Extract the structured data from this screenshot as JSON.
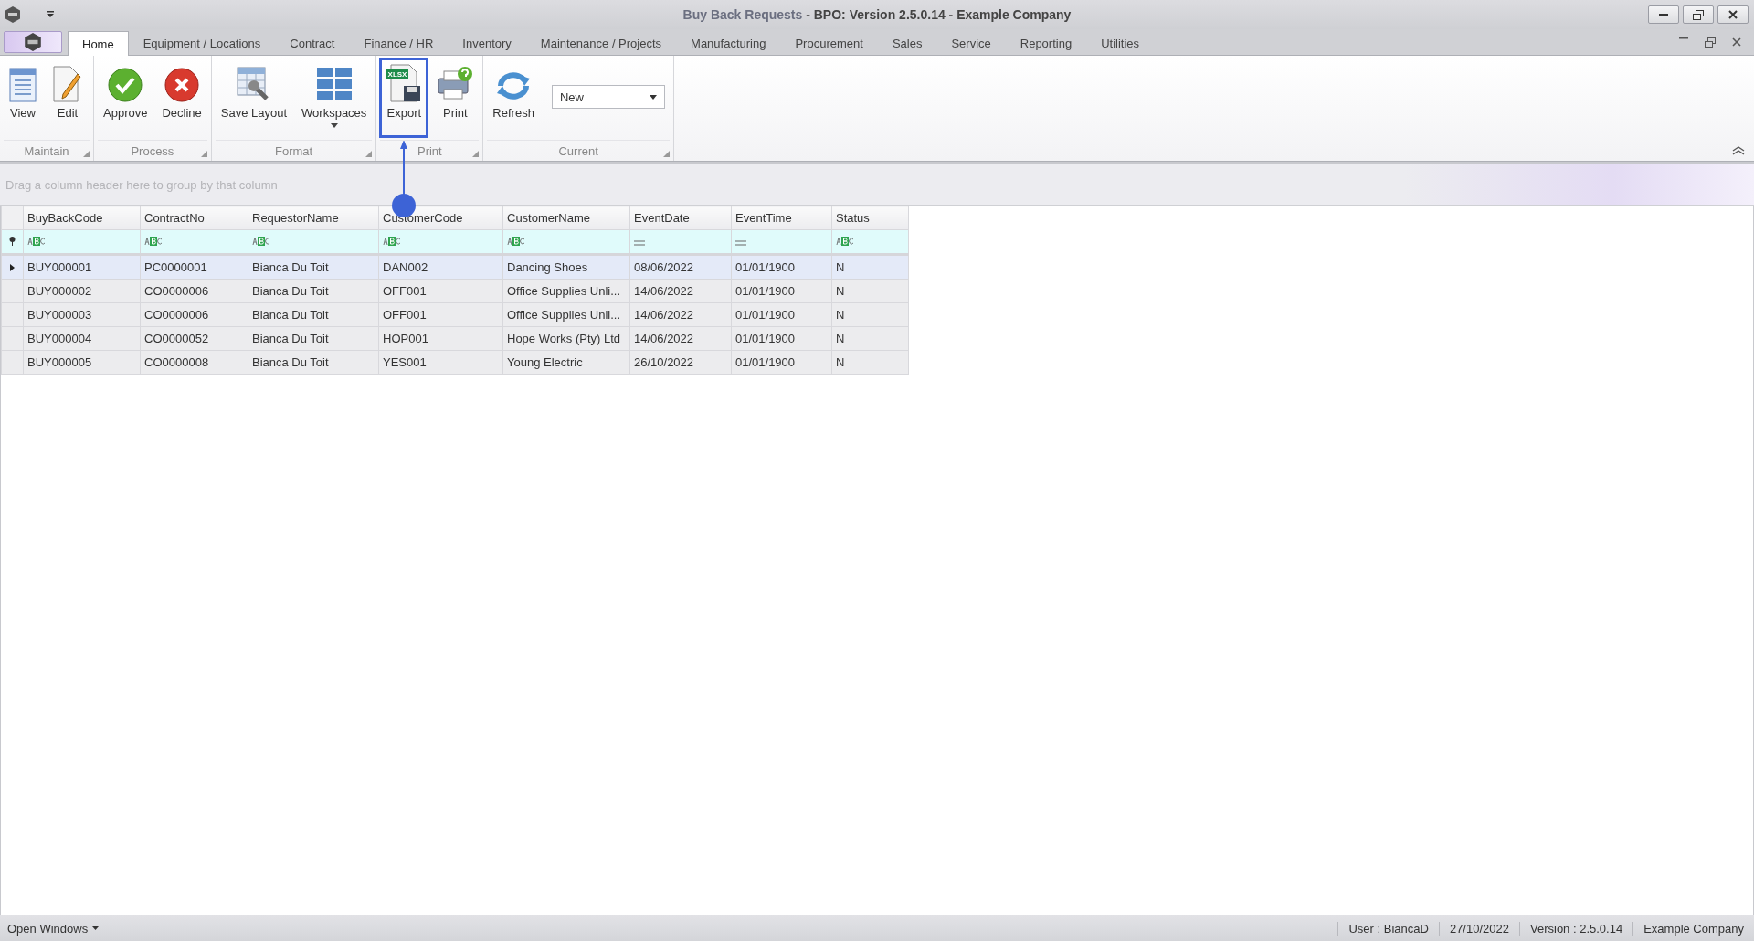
{
  "window": {
    "title_document": "Buy Back Requests",
    "title_app": "- BPO: Version 2.5.0.14 - Example Company"
  },
  "tabs": [
    {
      "label": "Home",
      "selected": true
    },
    {
      "label": "Equipment / Locations",
      "selected": false
    },
    {
      "label": "Contract",
      "selected": false
    },
    {
      "label": "Finance / HR",
      "selected": false
    },
    {
      "label": "Inventory",
      "selected": false
    },
    {
      "label": "Maintenance / Projects",
      "selected": false
    },
    {
      "label": "Manufacturing",
      "selected": false
    },
    {
      "label": "Procurement",
      "selected": false
    },
    {
      "label": "Sales",
      "selected": false
    },
    {
      "label": "Service",
      "selected": false
    },
    {
      "label": "Reporting",
      "selected": false
    },
    {
      "label": "Utilities",
      "selected": false
    }
  ],
  "ribbon": {
    "groups": [
      {
        "label": "Maintain",
        "items": [
          {
            "kind": "button",
            "label": "View",
            "highlighted": false
          },
          {
            "kind": "button",
            "label": "Edit",
            "highlighted": false
          }
        ]
      },
      {
        "label": "Process",
        "items": [
          {
            "kind": "button",
            "label": "Approve",
            "highlighted": false
          },
          {
            "kind": "button",
            "label": "Decline",
            "highlighted": false
          }
        ]
      },
      {
        "label": "Format",
        "items": [
          {
            "kind": "button",
            "label": "Save Layout",
            "highlighted": false
          },
          {
            "kind": "menu-button",
            "label": "Workspaces",
            "highlighted": false
          }
        ]
      },
      {
        "label": "Print",
        "items": [
          {
            "kind": "button",
            "label": "Export",
            "badge": "XLSX",
            "highlighted": true
          },
          {
            "kind": "button",
            "label": "Print",
            "highlighted": false
          }
        ]
      },
      {
        "label": "Current",
        "items": [
          {
            "kind": "button",
            "label": "Refresh",
            "highlighted": false
          },
          {
            "kind": "combo",
            "value": "New"
          }
        ]
      }
    ]
  },
  "grid": {
    "group_panel_hint": "Drag a column header here to group by that column",
    "columns": [
      {
        "label": "BuyBackCode",
        "kind": "text"
      },
      {
        "label": "ContractNo",
        "kind": "text"
      },
      {
        "label": "RequestorName",
        "kind": "text"
      },
      {
        "label": "CustomerCode",
        "kind": "text"
      },
      {
        "label": "CustomerName",
        "kind": "text"
      },
      {
        "label": "EventDate",
        "kind": "date"
      },
      {
        "label": "EventTime",
        "kind": "date"
      },
      {
        "label": "Status",
        "kind": "text"
      }
    ],
    "rows": [
      {
        "selected": true,
        "cells": [
          "BUY000001",
          "PC0000001",
          "Bianca Du Toit",
          "DAN002",
          "Dancing Shoes",
          "08/06/2022",
          "01/01/1900",
          "N"
        ]
      },
      {
        "selected": false,
        "cells": [
          "BUY000002",
          "CO0000006",
          "Bianca Du Toit",
          "OFF001",
          "Office Supplies Unli...",
          "14/06/2022",
          "01/01/1900",
          "N"
        ]
      },
      {
        "selected": false,
        "cells": [
          "BUY000003",
          "CO0000006",
          "Bianca Du Toit",
          "OFF001",
          "Office Supplies Unli...",
          "14/06/2022",
          "01/01/1900",
          "N"
        ]
      },
      {
        "selected": false,
        "cells": [
          "BUY000004",
          "CO0000052",
          "Bianca Du Toit",
          "HOP001",
          "Hope Works (Pty) Ltd",
          "14/06/2022",
          "01/01/1900",
          "N"
        ]
      },
      {
        "selected": false,
        "cells": [
          "BUY000005",
          "CO0000008",
          "Bianca Du Toit",
          "YES001",
          "Young Electric",
          "26/10/2022",
          "01/01/1900",
          "N"
        ]
      }
    ]
  },
  "status_bar": {
    "open_windows": "Open Windows",
    "items": [
      "User : BiancaD",
      "27/10/2022",
      "Version : 2.5.0.14",
      "Example Company"
    ]
  }
}
